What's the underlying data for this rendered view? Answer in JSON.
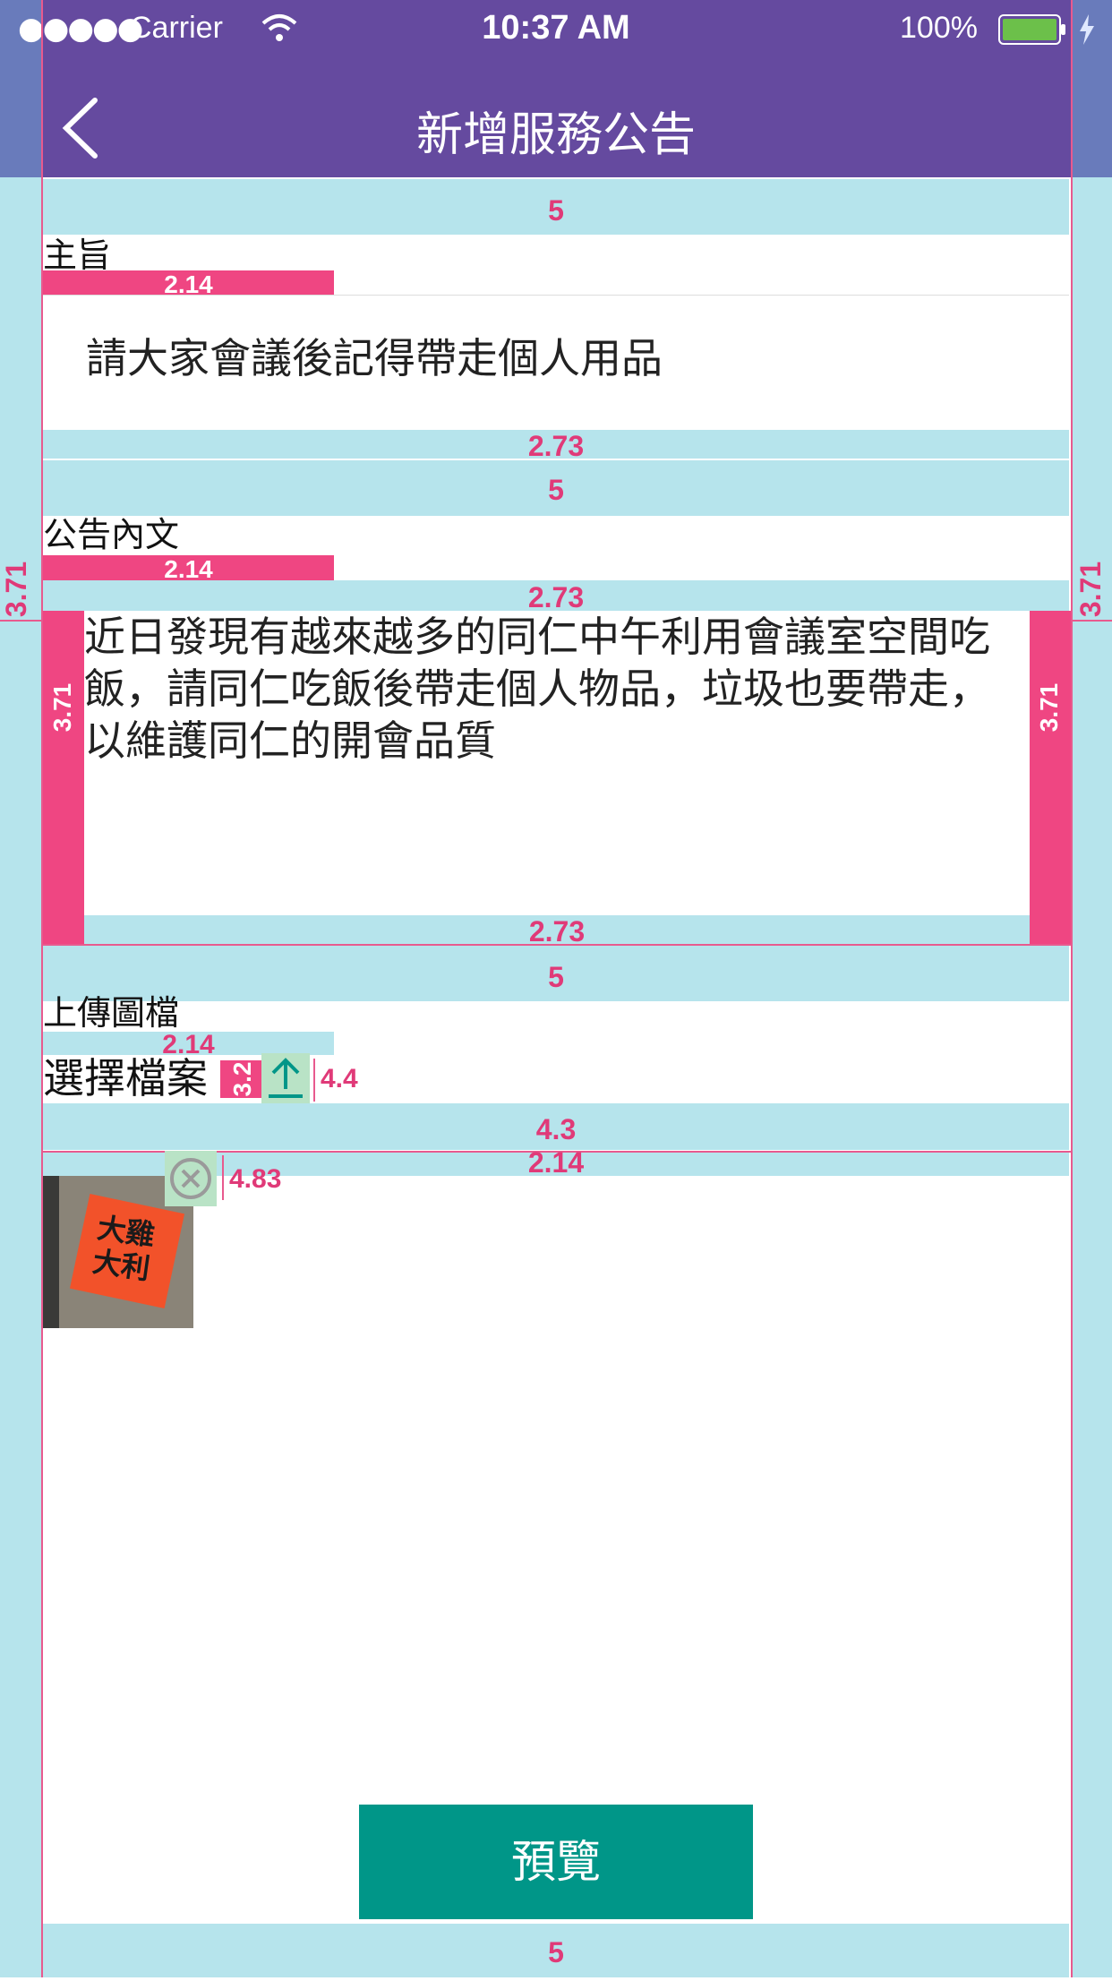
{
  "status_bar": {
    "signal": "●●●●●",
    "carrier": "Carrier",
    "time": "10:37 AM",
    "battery": "100%"
  },
  "nav": {
    "title": "新增服務公告"
  },
  "form": {
    "subject_label": "主旨",
    "subject_value": "請大家會議後記得帶走個人用品",
    "content_label": "公告內文",
    "content_value": "近日發現有越來越多的同仁中午利用會議室空間吃飯，請同仁吃飯後帶走個人物品，垃圾也要帶走，以維護同仁的開會品質",
    "upload_label": "上傳圖檔",
    "choose_file": "選擇檔案",
    "thumbnail_text": "大雞大利",
    "preview_button": "預覽"
  },
  "annotations": {
    "gap_5": "5",
    "gap_2_73": "2.73",
    "gap_2_14": "2.14",
    "side_3_71": "3.71",
    "icon_gap_3_2": "3.2",
    "upload_icon_4_4": "4.4",
    "row_4_3": "4.3",
    "close_4_83": "4.83"
  },
  "colors": {
    "nav_bg": "#654a9f",
    "accent": "#009688",
    "spacing_overlay": "#b6e4ec",
    "measure": "#ef4682"
  },
  "icons": {
    "back": "chevron-left-icon",
    "wifi": "wifi-icon",
    "battery": "battery-icon",
    "charging": "bolt-icon",
    "upload": "upload-icon",
    "close": "close-circle-icon"
  }
}
